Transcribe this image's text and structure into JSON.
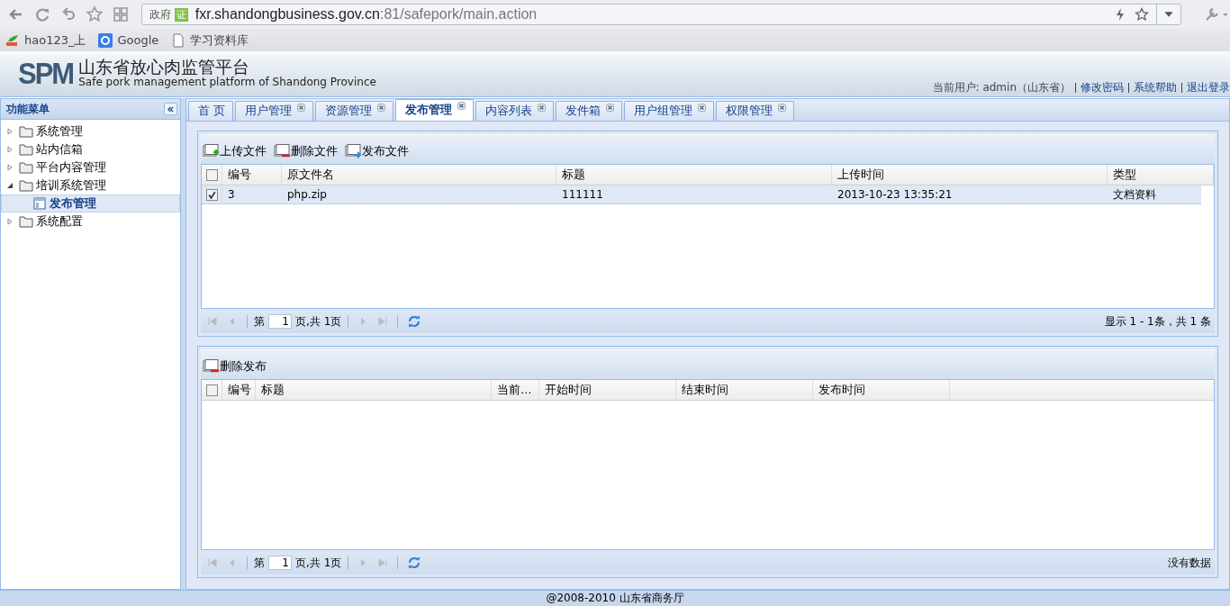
{
  "browser": {
    "url": {
      "badge": "政府",
      "cert": "证",
      "host": "fxr.shandongbusiness.gov.cn",
      "rest": ":81/safepork/main.action"
    },
    "bookmarks": [
      {
        "kind": "hao",
        "label": "hao123_上"
      },
      {
        "kind": "google",
        "label": "Google"
      },
      {
        "kind": "page",
        "label": "学习资料库"
      }
    ]
  },
  "header": {
    "logo": "SPM",
    "title": "山东省放心肉监管平台",
    "subtitle": "Safe pork management platform of Shandong Province",
    "user": "当前用户: admin（山东省）",
    "links": [
      "修改密码",
      "系统帮助",
      "退出登录"
    ]
  },
  "sidebar": {
    "title": "功能菜单",
    "items": [
      {
        "label": "系统管理",
        "expanded": false,
        "selected": false
      },
      {
        "label": "站内信箱",
        "expanded": false,
        "selected": false
      },
      {
        "label": "平台内容管理",
        "expanded": false,
        "selected": false
      },
      {
        "label": "培训系统管理",
        "expanded": true,
        "selected": false,
        "children": [
          {
            "label": "发布管理",
            "selected": true
          }
        ]
      },
      {
        "label": "系统配置",
        "expanded": false,
        "selected": false
      }
    ]
  },
  "tabs": [
    {
      "label": "首 页",
      "closable": false,
      "selected": false
    },
    {
      "label": "用户管理",
      "closable": true,
      "selected": false
    },
    {
      "label": "资源管理",
      "closable": true,
      "selected": false
    },
    {
      "label": "发布管理",
      "closable": true,
      "selected": true
    },
    {
      "label": "内容列表",
      "closable": true,
      "selected": false
    },
    {
      "label": "发件箱",
      "closable": true,
      "selected": false
    },
    {
      "label": "用户组管理",
      "closable": true,
      "selected": false
    },
    {
      "label": "权限管理",
      "closable": true,
      "selected": false
    }
  ],
  "grids": [
    {
      "toolbar": [
        {
          "kind": "add",
          "label": "上传文件"
        },
        {
          "kind": "delete",
          "label": "删除文件"
        },
        {
          "kind": "publish",
          "label": "发布文件"
        }
      ],
      "header_checked": false,
      "columns": [
        "编号",
        "原文件名",
        "标题",
        "上传时间",
        "类型"
      ],
      "rows": [
        {
          "checked": true,
          "selected": true,
          "cells": [
            "3",
            "php.zip",
            "111111",
            "2013-10-23 13:35:21",
            "文档资料"
          ]
        }
      ],
      "pager": {
        "before": "第",
        "page": "1",
        "after": "页,共 1页",
        "status": "显示 1 - 1条，共 1 条"
      }
    },
    {
      "toolbar": [
        {
          "kind": "delete",
          "label": "删除发布"
        }
      ],
      "header_checked": false,
      "columns": [
        "编号",
        "标题",
        "当前…",
        "开始时间",
        "结束时间",
        "发布时间"
      ],
      "pager": {
        "before": "第",
        "page": "1",
        "after": "页,共 1页",
        "status": "没有数据"
      }
    }
  ],
  "footer": "@2008-2010 山东省商务厅"
}
